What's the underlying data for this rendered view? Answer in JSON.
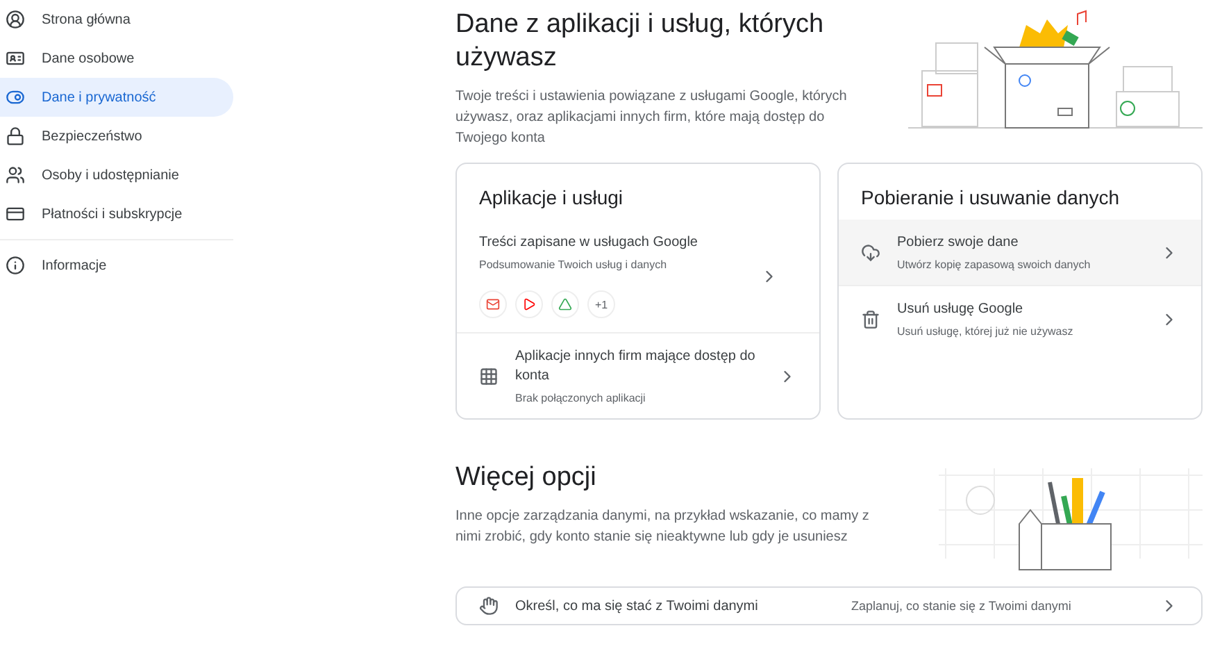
{
  "sidebar": {
    "items": [
      {
        "label": "Strona główna",
        "selected": false
      },
      {
        "label": "Dane osobowe",
        "selected": false
      },
      {
        "label": "Dane i prywatność",
        "selected": true
      },
      {
        "label": "Bezpieczeństwo",
        "selected": false
      },
      {
        "label": "Osoby i udostępnianie",
        "selected": false
      },
      {
        "label": "Płatności i subskrypcje",
        "selected": false
      },
      {
        "label": "Informacje",
        "selected": false
      }
    ]
  },
  "section": {
    "title": "Dane z aplikacji i usług, których używasz",
    "description": "Twoje treści i ustawienia powiązane z usługami Google, których używasz, oraz aplikacjami innych firm, które mają dostęp do Twojego konta"
  },
  "cards": [
    {
      "title": "Aplikacje i usługi",
      "rows": [
        {
          "kind": "apps",
          "title": "Treści zapisane w usługach Google",
          "subtitle": "Podsumowanie Twoich usług i danych",
          "more_apps": "+1"
        },
        {
          "kind": "icon",
          "title": "Aplikacje innych firm mające dostęp do konta",
          "subtitle": "Brak połączonych aplikacji"
        }
      ]
    },
    {
      "title": "Pobieranie i usuwanie danych",
      "rows": [
        {
          "kind": "icon",
          "title": "Pobierz swoje dane",
          "subtitle": "Utwórz kopię zapasową swoich danych"
        },
        {
          "kind": "icon",
          "title": "Usuń usługę Google",
          "subtitle": "Usuń usługę, której już nie używasz"
        }
      ]
    }
  ],
  "more": {
    "title": "Więcej opcji",
    "description": "Inne opcje zarządzania danymi, na przykład wskazanie, co mamy z nimi zrobić, gdy konto stanie się nieaktywne lub gdy je usuniesz",
    "row": {
      "title": "Określ, co ma się stać z Twoimi danymi",
      "subtitle": "Zaplanuj, co stanie się z Twoimi danymi"
    }
  }
}
